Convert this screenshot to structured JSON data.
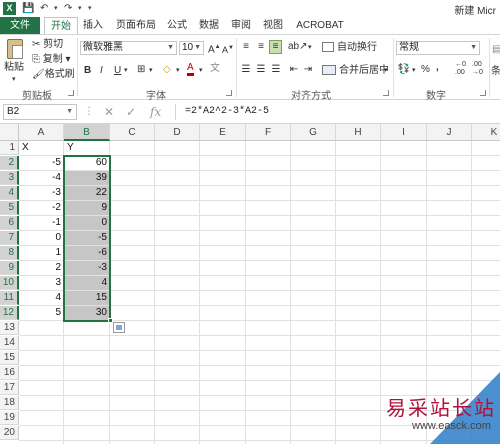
{
  "titlebar": {
    "logo": "X",
    "doc_title": "新建 Micr",
    "undo_icon": "undo-icon",
    "redo_icon": "redo-icon",
    "save_icon": "save-icon"
  },
  "tabs": [
    "开始",
    "插入",
    "页面布局",
    "公式",
    "数据",
    "审阅",
    "视图",
    "ACROBAT"
  ],
  "file_tab": "文件",
  "ribbon": {
    "clipboard": {
      "label": "剪贴板",
      "paste": "粘贴",
      "cut": "剪切",
      "copy": "复制",
      "format_painter": "格式刷"
    },
    "font": {
      "label": "字体",
      "font_name": "微软雅黑",
      "font_size": "10",
      "bold": "B",
      "italic": "I",
      "underline": "U",
      "grow": "A",
      "shrink": "A",
      "font_color": "A"
    },
    "alignment": {
      "label": "对齐方式",
      "wrap_text": "自动换行",
      "merge_center": "合并后居中"
    },
    "number": {
      "label": "数字",
      "format": "常规",
      "percent": "%",
      "comma": ",",
      "inc_dec": ".00",
      "dec_dec": ".00"
    },
    "styles": {
      "label": "条"
    }
  },
  "formula_bar": {
    "name_box": "B2",
    "cancel": "✕",
    "enter": "✓",
    "fx": "fx",
    "formula": "=2*A2^2-3*A2-5"
  },
  "columns": [
    "A",
    "B",
    "C",
    "D",
    "E",
    "F",
    "G",
    "H",
    "I",
    "J",
    "K"
  ],
  "rows": [
    "1",
    "2",
    "3",
    "4",
    "5",
    "6",
    "7",
    "8",
    "9",
    "10",
    "11",
    "12",
    "13",
    "14",
    "15",
    "16",
    "17",
    "18",
    "19",
    "20"
  ],
  "cells": {
    "A1": "X",
    "B1": "Y",
    "A": [
      "-5",
      "-4",
      "-3",
      "-2",
      "-1",
      "0",
      "1",
      "2",
      "3",
      "4",
      "5"
    ],
    "B": [
      "60",
      "39",
      "22",
      "9",
      "0",
      "-5",
      "-6",
      "-3",
      "4",
      "15",
      "30"
    ]
  },
  "watermark": {
    "text": "易采站长站",
    "url": "www.easck.com"
  },
  "colors": {
    "accent": "#217346",
    "selection": "#c6c6c6"
  }
}
